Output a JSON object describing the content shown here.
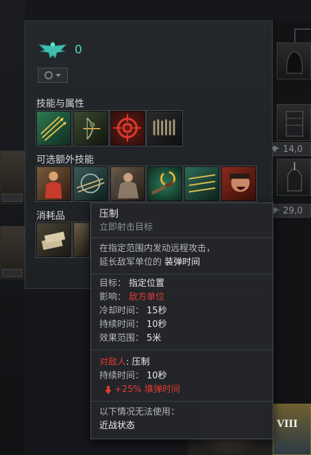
{
  "faction": {
    "count": "0",
    "emblem": "eagle-emblem-icon"
  },
  "sections": {
    "skills_title": "技能与属性",
    "optional_title": "可选额外技能",
    "consumables_title": "消耗品"
  },
  "side_prices": [
    {
      "value": "14,0"
    },
    {
      "value": "29,0"
    }
  ],
  "bottom_card": {
    "rank": "VIII"
  },
  "tooltip": {
    "title": "压制",
    "subtitle": "立即射击目标",
    "desc_line1": "在指定范围内发动远程攻击，",
    "desc_line2_prefix": "延长敌军单位的 ",
    "desc_line2_highlight": "装弹时间",
    "stats": [
      {
        "key": "目标：",
        "value": "指定位置",
        "color": "normal"
      },
      {
        "key": "影响：",
        "value": "敌方单位",
        "color": "red"
      },
      {
        "key": "冷却时间：",
        "value": "15秒",
        "color": "normal"
      },
      {
        "key": "持续时间：",
        "value": "10秒",
        "color": "normal"
      },
      {
        "key": "效果范围：",
        "value": "5米",
        "color": "normal"
      }
    ],
    "effect_target": "对敌人",
    "effect_name": ": 压制",
    "effect_duration_key": "持续时间：",
    "effect_duration_value": "10秒",
    "effect_modifier": "+25% 填弹时间",
    "limit_title": "以下情况无法使用：",
    "limit_item": "近战状态"
  },
  "colors": {
    "accent": "#4fd8c4",
    "negative": "#e23b32"
  }
}
